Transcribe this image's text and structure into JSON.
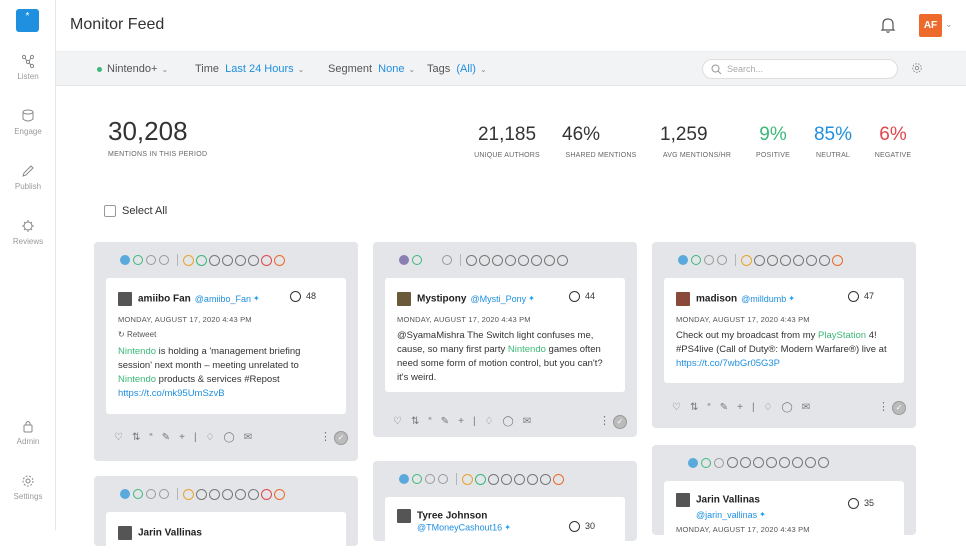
{
  "nav": [
    {
      "label": "Listen",
      "icon": "listen-icon"
    },
    {
      "label": "Engage",
      "icon": "engage-icon"
    },
    {
      "label": "Publish",
      "icon": "publish-icon"
    },
    {
      "label": "Reviews",
      "icon": "reviews-icon"
    },
    {
      "label": "Admin",
      "icon": "lock-icon"
    },
    {
      "label": "Settings",
      "icon": "gear-icon"
    }
  ],
  "header": {
    "title": "Monitor Feed",
    "avatar_initials": "AF"
  },
  "filters": {
    "profile": "Nintendo+",
    "time_label": "Time",
    "time_value": "Last 24 Hours",
    "segment_label": "Segment",
    "segment_value": "None",
    "tags_label": "Tags",
    "tags_value": "(All)",
    "search_placeholder": "Search..."
  },
  "stats": {
    "mentions": "30,208",
    "mentions_label": "MENTIONS IN THIS PERIOD",
    "items": [
      {
        "value": "21,185",
        "label": "UNIQUE AUTHORS",
        "color": "#333333"
      },
      {
        "value": "46%",
        "label": "SHARED MENTIONS",
        "color": "#333333"
      },
      {
        "value": "1,259",
        "label": "AVG MENTIONS/HR",
        "color": "#333333"
      },
      {
        "value": "9%",
        "label": "POSITIVE",
        "color": "#3cb878"
      },
      {
        "value": "85%",
        "label": "NEUTRAL",
        "color": "#1f8fe0"
      },
      {
        "value": "6%",
        "label": "NEGATIVE",
        "color": "#e0474c"
      }
    ]
  },
  "select_all": "Select All",
  "cards": [
    {
      "name": "amiibo Fan",
      "handle": "@amiibo_Fan",
      "score": "48",
      "date": "MONDAY, AUGUST 17, 2020 4:43 PM",
      "retweet": "Retweet",
      "text": [
        [
          "g",
          "Nintendo"
        ],
        [
          "t",
          " is holding a 'management briefing session' next month – meeting unrelated to "
        ],
        [
          "g",
          "Nintendo"
        ],
        [
          "t",
          " products & services #Repost "
        ],
        [
          "l",
          "https://t.co/mk95UmSzvB"
        ]
      ]
    },
    {
      "name": "Mystipony",
      "handle": "@Mysti_Pony",
      "score": "44",
      "date": "MONDAY, AUGUST 17, 2020 4:43 PM",
      "retweet": "",
      "text": [
        [
          "t",
          "@SyamaMishra The Switch light confuses me, cause, so many first party "
        ],
        [
          "g",
          "Nintendo"
        ],
        [
          "t",
          " games often need some form of motion control, but you can't? it's weird."
        ]
      ]
    },
    {
      "name": "madison",
      "handle": "@milldumb",
      "score": "47",
      "date": "MONDAY, AUGUST 17, 2020 4:43 PM",
      "retweet": "",
      "text": [
        [
          "t",
          "Check out my broadcast from my "
        ],
        [
          "g",
          "PlayStation"
        ],
        [
          "t",
          " 4! #PS4live (Call of Duty®: Modern Warfare®) live at "
        ],
        [
          "l",
          "https://t.co/7wbGr05G3P"
        ]
      ]
    },
    {
      "name": "Jarin Vallinas",
      "handle": "",
      "score": "",
      "date": "",
      "retweet": "",
      "text": []
    },
    {
      "name": "Tyree Johnson",
      "handle": "@TMoneyCashout16",
      "score": "30",
      "date": "",
      "retweet": "",
      "text": []
    },
    {
      "name": "Jarin Vallinas",
      "handle": "@jarin_vallinas",
      "score": "35",
      "date": "MONDAY, AUGUST 17, 2020 4:43 PM",
      "retweet": "",
      "text": []
    }
  ],
  "colors": {
    "accent": "#1f8fe0",
    "positive": "#3cb878",
    "negative": "#e0474c",
    "avatar": "#ee6a2c"
  }
}
